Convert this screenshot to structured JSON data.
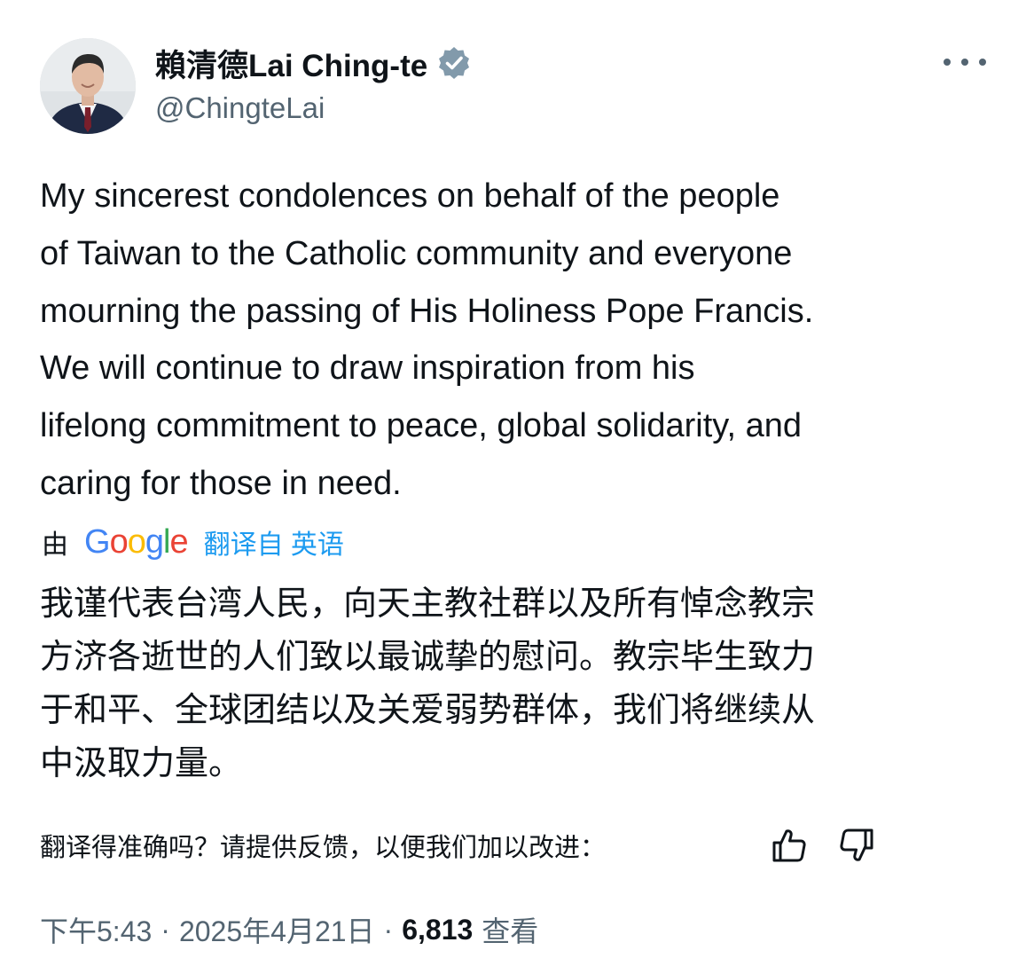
{
  "author": {
    "display_name": "賴清德Lai Ching-te",
    "handle": "@ChingteLai",
    "verified": true,
    "verified_color": "#829aab"
  },
  "tweet": {
    "text_lines": [
      "My sincerest condolences on behalf of the people",
      "of Taiwan to the Catholic community and everyone",
      "mourning the passing of His Holiness Pope Francis.",
      "We will continue to draw inspiration from his",
      "lifelong commitment to peace, global solidarity, and",
      "caring for those in need."
    ]
  },
  "translation": {
    "by_label": "由",
    "provider_logo_letters": [
      {
        "ch": "G",
        "color": "#4285f4"
      },
      {
        "ch": "o",
        "color": "#ea4335"
      },
      {
        "ch": "o",
        "color": "#fbbc05"
      },
      {
        "ch": "g",
        "color": "#4285f4"
      },
      {
        "ch": "l",
        "color": "#34a853"
      },
      {
        "ch": "e",
        "color": "#ea4335"
      }
    ],
    "translated_from_label": "翻译自 英语",
    "link_color": "#1d9bf0",
    "text_lines": [
      "我谨代表台湾人民，向天主教社群以及所有悼念教宗",
      "方济各逝世的人们致以最诚挚的慰问。教宗毕生致力",
      "于和平、全球团结以及关爱弱势群体，我们将继续从",
      "中汲取力量。"
    ],
    "feedback_prompt": "翻译得准确吗？请提供反馈，以便我们加以改进："
  },
  "meta": {
    "time": "下午5:43",
    "separator": "·",
    "date": "2025年4月21日",
    "views_count": "6,813",
    "views_label": "查看"
  },
  "icons": {
    "more": "more-horizontal-icon",
    "verified": "verified-badge-icon",
    "thumb_up": "thumbs-up-icon",
    "thumb_down": "thumbs-down-icon"
  }
}
